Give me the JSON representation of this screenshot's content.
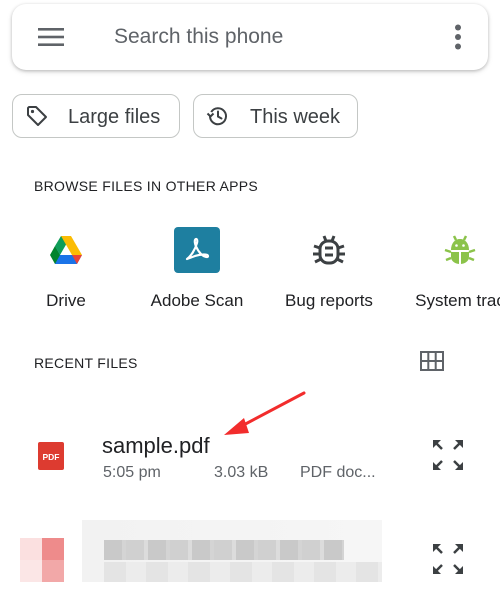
{
  "search": {
    "placeholder": "Search this phone"
  },
  "icons": {
    "menu": "menu-icon",
    "more": "more-vert-icon",
    "large_files": "tag-icon",
    "this_week": "history-icon",
    "grid_view": "grid-view-icon",
    "expand": "expand-icon",
    "annotation": "red-arrow"
  },
  "chips": [
    {
      "label": "Large files"
    },
    {
      "label": "This week"
    }
  ],
  "browse": {
    "header": "BROWSE FILES IN OTHER APPS",
    "apps": [
      {
        "label": "Drive"
      },
      {
        "label": "Adobe Scan"
      },
      {
        "label": "Bug reports"
      },
      {
        "label": "System trac"
      }
    ]
  },
  "recent": {
    "header": "RECENT FILES",
    "files": [
      {
        "name": "sample.pdf",
        "time": "5:05 pm",
        "size": "3.03 kB",
        "type": "PDF doc...",
        "icon_label": "PDF"
      }
    ]
  },
  "colors": {
    "adobe": "#1e7fa0",
    "pdf_red": "#dd3b30",
    "bug_android": "#8bc34a",
    "annotation_arrow": "#f22c2c"
  }
}
